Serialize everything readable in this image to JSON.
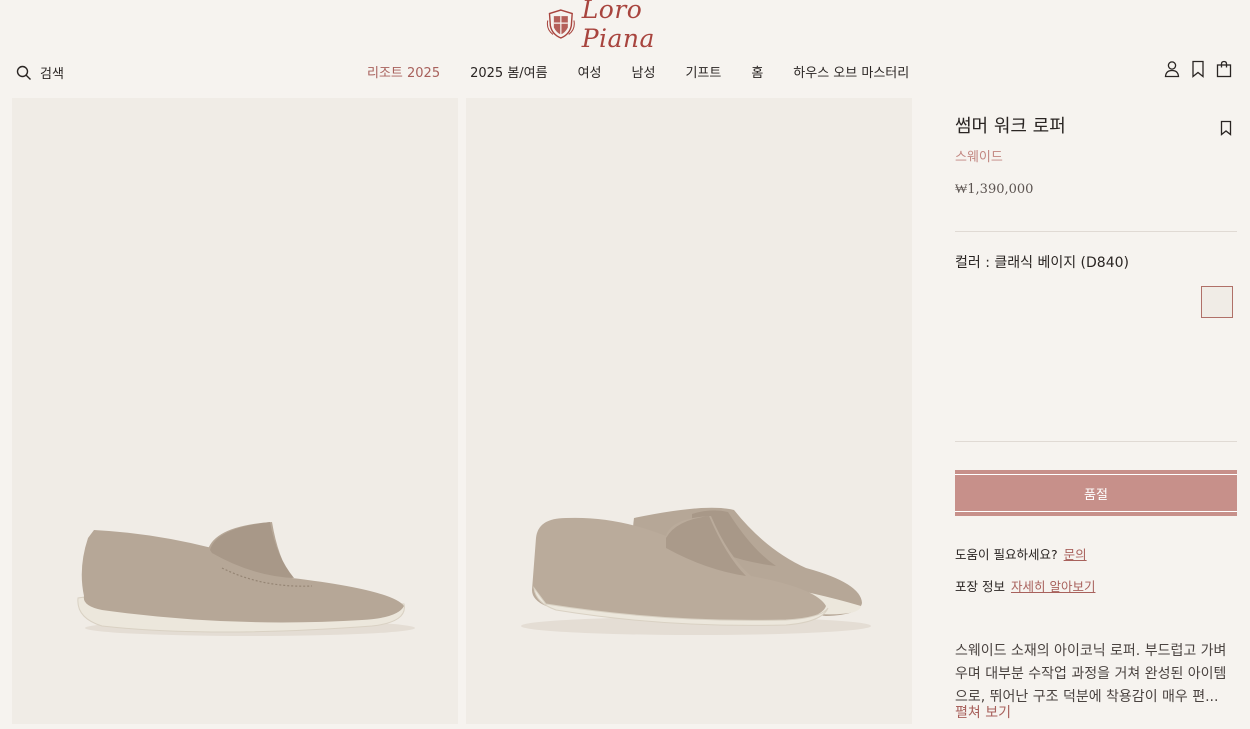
{
  "brand": {
    "name": "Loro Piana",
    "icon": "crest-logo-icon",
    "color": "#a8443e"
  },
  "header": {
    "search_label": "검색",
    "nav": [
      {
        "label": "리조트 2025",
        "active": true
      },
      {
        "label": "2025 봄/여름"
      },
      {
        "label": "여성"
      },
      {
        "label": "남성"
      },
      {
        "label": "기프트"
      },
      {
        "label": "홈"
      },
      {
        "label": "하우스 오브 마스터리"
      }
    ],
    "icons": [
      "account-icon",
      "bookmark-icon",
      "shopping-bag-icon"
    ]
  },
  "product": {
    "name": "썸머 워크 로퍼",
    "material": "스웨이드",
    "price": "₩1,390,000",
    "color_label": "컬러 : 클래식 베이지 (D840)",
    "cta_label": "품절",
    "help_text": "도움이 필요하세요?",
    "help_link": "문의",
    "packing_label": "포장 정보",
    "packing_link": "자세히 알아보기",
    "description": "스웨이드 소재의 아이코닉 로퍼. 부드럽고 가벼우며 대부분 수작업 과정을 거쳐 완성된 아이템으로, 뛰어난 구조 덕분에 착용감이 매우 편...",
    "more_label": "펼쳐 보기"
  },
  "colors": {
    "accent": "#a8615c",
    "cta": "#c7908a",
    "background": "#f6f3ef"
  }
}
